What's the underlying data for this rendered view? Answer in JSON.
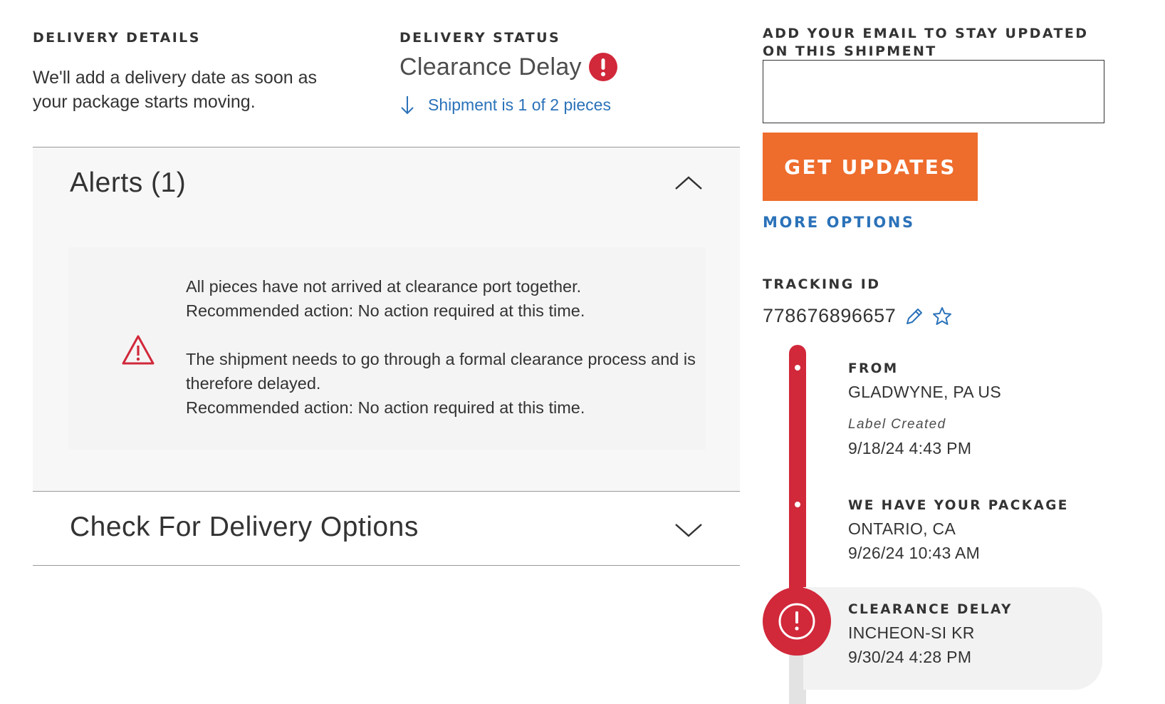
{
  "delivery_details": {
    "title": "DELIVERY DETAILS",
    "text": "We'll add a delivery date as soon as your package starts moving."
  },
  "delivery_status": {
    "title": "DELIVERY STATUS",
    "status": "Clearance Delay",
    "status_icon": "exclamation-circle-icon",
    "pieces_link": "Shipment is 1 of 2 pieces"
  },
  "alerts": {
    "title": "Alerts (1)",
    "expanded": true,
    "messages": [
      "All pieces have not arrived at clearance port together.\nRecommended action: No action required at this time.",
      "The shipment needs to go through a formal clearance process and is therefore delayed.\nRecommended action: No action required at this time."
    ]
  },
  "delivery_options": {
    "title": "Check For Delivery Options",
    "expanded": false
  },
  "email_updates": {
    "label": "ADD YOUR EMAIL TO STAY UPDATED ON THIS SHIPMENT",
    "input_value": "",
    "input_placeholder": "",
    "button_label": "GET UPDATES",
    "more_options": "MORE OPTIONS"
  },
  "tracking": {
    "label": "TRACKING ID",
    "number": "778676896657"
  },
  "timeline": {
    "events": [
      {
        "title": "FROM",
        "location": "GLADWYNE, PA US",
        "status": "Label Created",
        "time": "9/18/24 4:43 PM"
      },
      {
        "title": "WE HAVE YOUR PACKAGE",
        "location": "ONTARIO, CA",
        "time": "9/26/24 10:43 AM"
      },
      {
        "title": "CLEARANCE DELAY",
        "location": "INCHEON-SI KR",
        "time": "9/30/24 4:28 PM"
      }
    ]
  },
  "colors": {
    "accent_red": "#d1283a",
    "link_blue": "#2b72b9",
    "button_orange": "#ee6c2c"
  }
}
